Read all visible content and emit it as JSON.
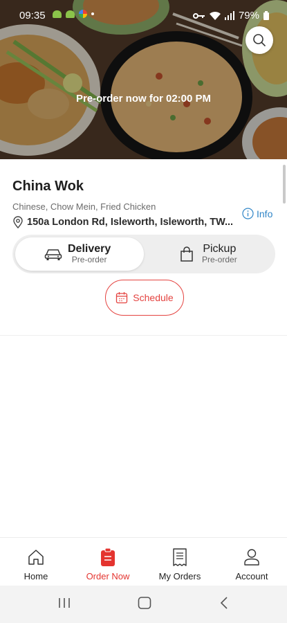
{
  "status_bar": {
    "time": "09:35",
    "battery": "79%"
  },
  "hero": {
    "preorder_text": "Pre-order now for 02:00 PM"
  },
  "restaurant": {
    "name": "China Wok",
    "cuisines": "Chinese, Chow Mein, Fried Chicken",
    "address": "150a London Rd, Isleworth, Isleworth, TW...",
    "info_label": "Info"
  },
  "order_mode": {
    "delivery": {
      "label": "Delivery",
      "sub": "Pre-order",
      "selected": true
    },
    "pickup": {
      "label": "Pickup",
      "sub": "Pre-order",
      "selected": false
    }
  },
  "schedule": {
    "label": "Schedule"
  },
  "bottom_nav": {
    "items": [
      {
        "label": "Home",
        "icon": "home-icon",
        "active": false
      },
      {
        "label": "Order Now",
        "icon": "order-now-icon",
        "active": true
      },
      {
        "label": "My Orders",
        "icon": "receipt-icon",
        "active": false
      },
      {
        "label": "Account",
        "icon": "account-icon",
        "active": false
      }
    ]
  },
  "colors": {
    "accent": "#e4342f",
    "info": "#2f85c7"
  }
}
